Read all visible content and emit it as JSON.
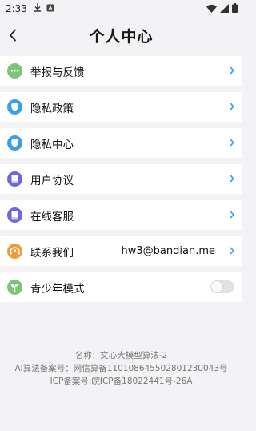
{
  "status_bar": {
    "time": "2:33"
  },
  "header": {
    "title": "个人中心"
  },
  "menu": [
    {
      "label": "举报与反馈",
      "icon": "chat-bubble-icon",
      "color": "#7cc576"
    },
    {
      "label": "隐私政策",
      "icon": "shield-icon",
      "color": "#3aa0e8"
    },
    {
      "label": "隐私中心",
      "icon": "shield-icon",
      "color": "#3aa0e8"
    },
    {
      "label": "用户协议",
      "icon": "book-icon",
      "color": "#6a67e0"
    },
    {
      "label": "在线客服",
      "icon": "book-icon",
      "color": "#6a67e0"
    },
    {
      "label": "联系我们",
      "value": "hw3@bandian.me",
      "icon": "contact-icon",
      "color": "#f2993a"
    },
    {
      "label": "青少年模式",
      "icon": "sprout-icon",
      "color": "#7cc576",
      "toggle": false
    }
  ],
  "colors": {
    "chevron": "#3aa0e8",
    "background": "#f3f3f6"
  },
  "footer": {
    "name": "名称：文心大模型算法-2",
    "ai_filing": "AI算法备案号：网信算备110108645502801230043号",
    "icp_filing": "ICP备案号:皖ICP备18022441号-26A"
  }
}
